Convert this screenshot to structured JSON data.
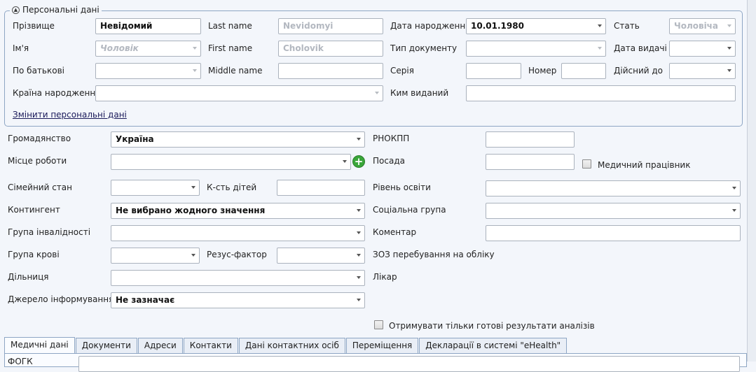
{
  "group": {
    "legend": "Персональні дані",
    "collapse_icon": "chevron-up-icon"
  },
  "personal": {
    "surname_label": "Прізвище",
    "surname_value": "Невідомий",
    "name_label": "Ім'я",
    "name_value": "Чоловік",
    "patronymic_label": "По батькові",
    "patronymic_value": "",
    "birth_country_label": "Країна народження",
    "birth_country_value": "",
    "last_name_label": "Last name",
    "last_name_value": "Nevidomyi",
    "first_name_label": "First name",
    "first_name_value": "Cholovik",
    "middle_name_label": "Middle name",
    "middle_name_value": "",
    "birth_date_label": "Дата народження",
    "birth_date_value": "10.01.1980",
    "doc_type_label": "Тип документу",
    "doc_type_value": "",
    "series_label": "Серія",
    "series_value": "",
    "number_label": "Номер",
    "number_value": "",
    "issued_by_label": "Ким виданий",
    "issued_by_value": "",
    "sex_label": "Стать",
    "sex_value": "Чоловіча",
    "issue_date_label": "Дата видачі",
    "issue_date_value": "",
    "valid_until_label": "Дійсний до",
    "valid_until_value": "",
    "change_link": "Змінити персональні дані"
  },
  "main": {
    "citizenship_label": "Громадянство",
    "citizenship_value": "Україна",
    "workplace_label": "Місце роботи",
    "workplace_value": "",
    "marital_label": "Сімейний стан",
    "marital_value": "",
    "children_label": "К-сть дітей",
    "children_value": "",
    "contingent_label": "Контингент",
    "contingent_value": "Не вибрано жодного значення",
    "disability_label": "Група інвалідності",
    "disability_value": "",
    "blood_label": "Група крові",
    "blood_value": "",
    "rh_label": "Резус-фактор",
    "rh_value": "",
    "district_label": "Дільниця",
    "district_value": "",
    "info_source_label": "Джерело інформування*",
    "info_source_value": "Не зазначає",
    "rnokpp_label": "РНОКПП",
    "rnokpp_value": "",
    "position_label": "Посада",
    "position_value": "",
    "medical_worker_label": "Медичний працівник",
    "education_label": "Рівень освіти",
    "education_value": "",
    "social_group_label": "Соціальна група",
    "social_group_value": "",
    "comment_label": "Коментар",
    "comment_value": "",
    "zoz_label": "ЗОЗ перебування на обліку",
    "doctor_label": "Лікар",
    "ready_results_label": "Отримувати тільки готові результати аналізів"
  },
  "tabs": [
    "Медичні дані",
    "Документи",
    "Адреси",
    "Контакти",
    "Дані контактних осіб",
    "Переміщення",
    "Декларації в системі \"eHealth\""
  ],
  "panel": {
    "first_label": "ФОГК"
  }
}
